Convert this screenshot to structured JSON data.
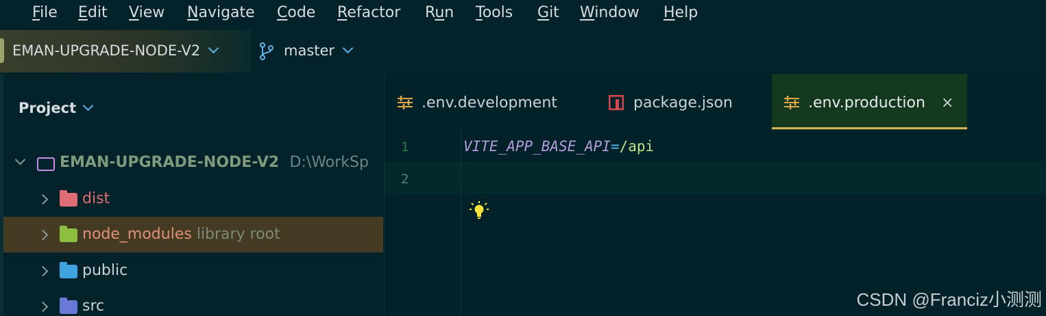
{
  "menu": [
    {
      "mnemonic": "F",
      "rest": "ile"
    },
    {
      "mnemonic": "E",
      "rest": "dit"
    },
    {
      "mnemonic": "V",
      "rest": "iew"
    },
    {
      "mnemonic": "N",
      "rest": "avigate"
    },
    {
      "mnemonic": "C",
      "rest": "ode"
    },
    {
      "mnemonic": "R",
      "rest": "efactor"
    },
    {
      "pre": "R",
      "mnemonic": "u",
      "rest": "n"
    },
    {
      "mnemonic": "T",
      "rest": "ools"
    },
    {
      "mnemonic": "G",
      "rest": "it"
    },
    {
      "mnemonic": "W",
      "rest": "indow"
    },
    {
      "mnemonic": "H",
      "rest": "elp"
    }
  ],
  "toolbar": {
    "project_name": "EMAN-UPGRADE-NODE-V2",
    "branch_name": "master"
  },
  "project_panel": {
    "title": "Project",
    "root": {
      "name": "EMAN-UPGRADE-NODE-V2",
      "path": "D:\\WorkSp"
    },
    "items": [
      {
        "name": "dist",
        "suffix": "",
        "icon": "dist-folder-icon",
        "color": "#e06c75"
      },
      {
        "name": "node_modules",
        "suffix": "library root",
        "icon": "node-modules-folder-icon",
        "color": "#e06c75"
      },
      {
        "name": "public",
        "suffix": "",
        "icon": "public-folder-icon",
        "color": "#c9d3d6"
      },
      {
        "name": "src",
        "suffix": "",
        "icon": "source-folder-icon",
        "color": "#c9d3d6"
      }
    ]
  },
  "tabs": [
    {
      "label": ".env.development",
      "icon": "env-settings-icon",
      "active": false
    },
    {
      "label": "package.json",
      "icon": "npm-icon",
      "active": false
    },
    {
      "label": ".env.production",
      "icon": "env-settings-icon",
      "active": true,
      "close": "×"
    }
  ],
  "editor": {
    "line_numbers": [
      "1",
      "2"
    ],
    "line1": {
      "key": "VITE_APP_BASE_API",
      "eq": "=",
      "value": "/api"
    }
  },
  "watermark": "CSDN @Franciz小测测",
  "colors": {
    "background": "#032129",
    "active_tab": "#14381e",
    "tab_underline": "#d9b457",
    "selected_row": "#443b22"
  }
}
